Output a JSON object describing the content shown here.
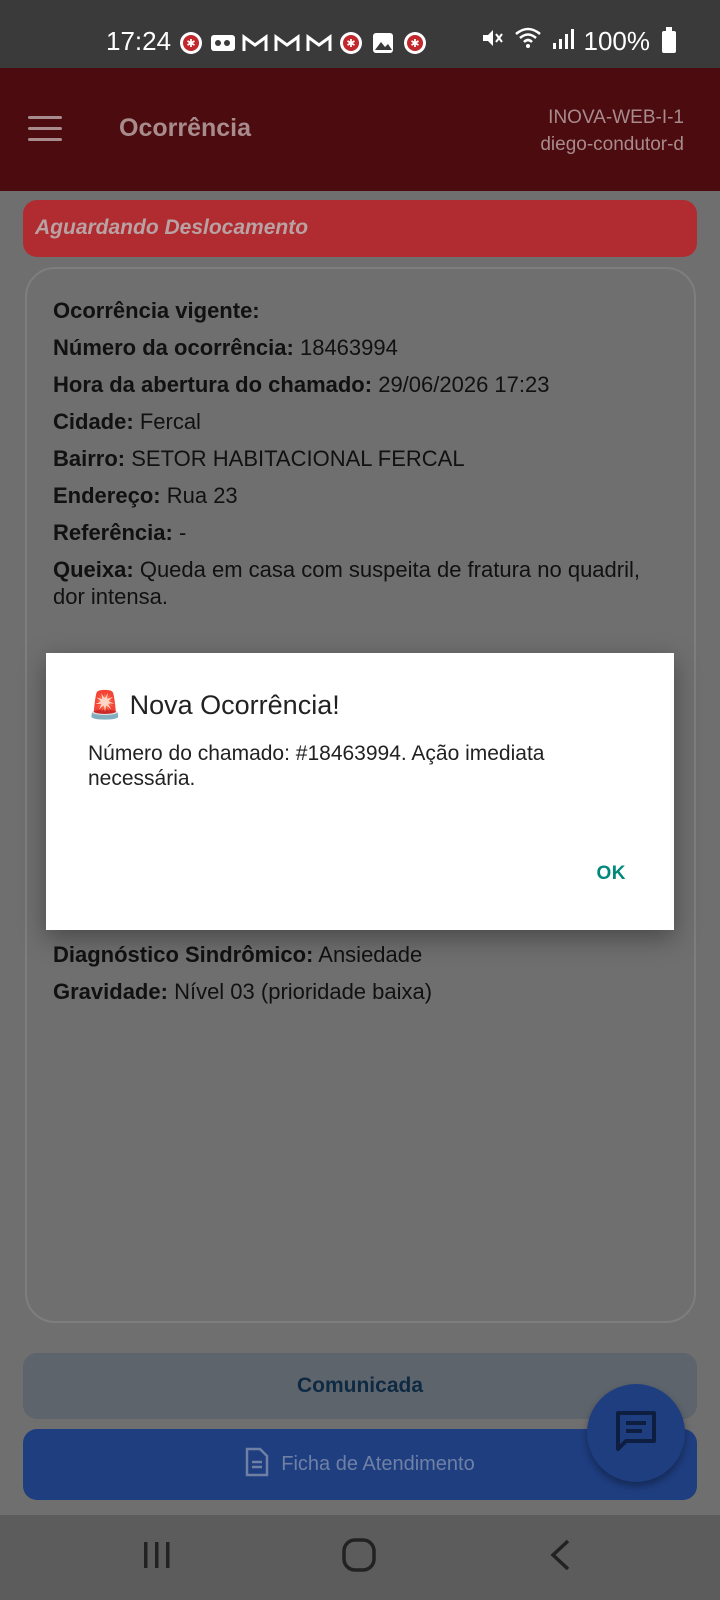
{
  "status_bar": {
    "time": "17:24",
    "battery": "100%",
    "left_icons": [
      "samu-icon",
      "voicemail-icon",
      "gmail-icon",
      "gmail-icon",
      "gmail-icon",
      "samu-icon",
      "gallery-icon",
      "samu-icon"
    ],
    "right_icons": [
      "mute-icon",
      "wifi-icon",
      "signal-icon",
      "battery-icon"
    ]
  },
  "app_bar": {
    "title": "Ocorrência",
    "server": "INOVA-WEB-I-1",
    "user": "diego-condutor-d"
  },
  "status_banner": "Aguardando Deslocamento",
  "occurrence": {
    "heading": "Ocorrência vigente:",
    "fields": [
      {
        "label": "Número da ocorrência:",
        "value": "18463994"
      },
      {
        "label": "Hora da abertura do chamado:",
        "value": "29/06/2026 17:23"
      },
      {
        "label": "Cidade:",
        "value": "Fercal"
      },
      {
        "label": "Bairro:",
        "value": "SETOR HABITACIONAL FERCAL"
      },
      {
        "label": "Endereço:",
        "value": "Rua 23"
      },
      {
        "label": "Referência:",
        "value": "-"
      },
      {
        "label": "Queixa:",
        "value": "Queda em casa com suspeita de fratura no quadril, dor intensa."
      }
    ],
    "lower_fields": [
      {
        "label": "Diagnóstico Sindrômico:",
        "value": "Ansiedade"
      },
      {
        "label": "Gravidade:",
        "value": "Nível 03 (prioridade baixa)"
      }
    ]
  },
  "buttons": {
    "comunicada": "Comunicada",
    "ficha": "Ficha de Atendimento"
  },
  "dialog": {
    "emoji": "🚨",
    "title": "Nova Ocorrência!",
    "message": "Número do chamado: #18463994. Ação imediata necessária.",
    "ok": "OK"
  },
  "colors": {
    "app_bar": "#4c0b0e",
    "banner": "#b02c30",
    "primary_button": "#1f3e80",
    "dialog_ok": "#00897b"
  }
}
